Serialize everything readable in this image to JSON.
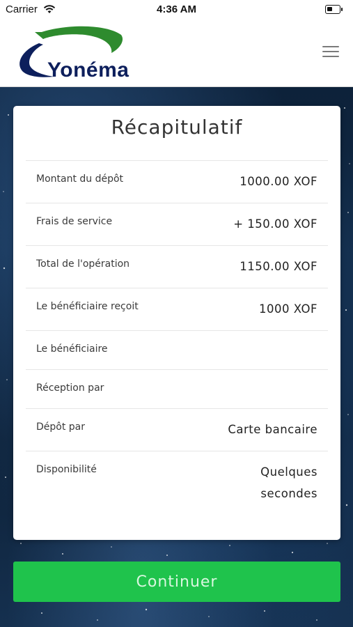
{
  "status_bar": {
    "carrier": "Carrier",
    "time": "4:36 AM",
    "wifi_icon": "wifi-icon",
    "battery_icon": "battery-icon"
  },
  "header": {
    "logo_text": "Yonéma",
    "menu_icon": "hamburger-menu-icon",
    "logo_colors": {
      "green": "#2e8b2e",
      "navy": "#0d1f5c"
    }
  },
  "summary": {
    "title": "Récapitulatif",
    "rows": [
      {
        "label": "Montant du dépôt",
        "value": "1000.00 XOF"
      },
      {
        "label": "Frais de service",
        "value": "+ 150.00 XOF"
      },
      {
        "label": "Total de l'opération",
        "value": "1150.00 XOF"
      },
      {
        "label": "Le bénéficiaire reçoit",
        "value": "1000 XOF"
      },
      {
        "label": "Le bénéficiaire",
        "value": ""
      },
      {
        "label": "Réception par",
        "value": ""
      },
      {
        "label": "Dépôt par",
        "value": "Carte bancaire"
      },
      {
        "label": "Disponibilité",
        "value_lines": [
          "Quelques",
          "secondes"
        ]
      }
    ]
  },
  "actions": {
    "continue_label": "Continuer",
    "continue_color": "#1fc34c"
  }
}
